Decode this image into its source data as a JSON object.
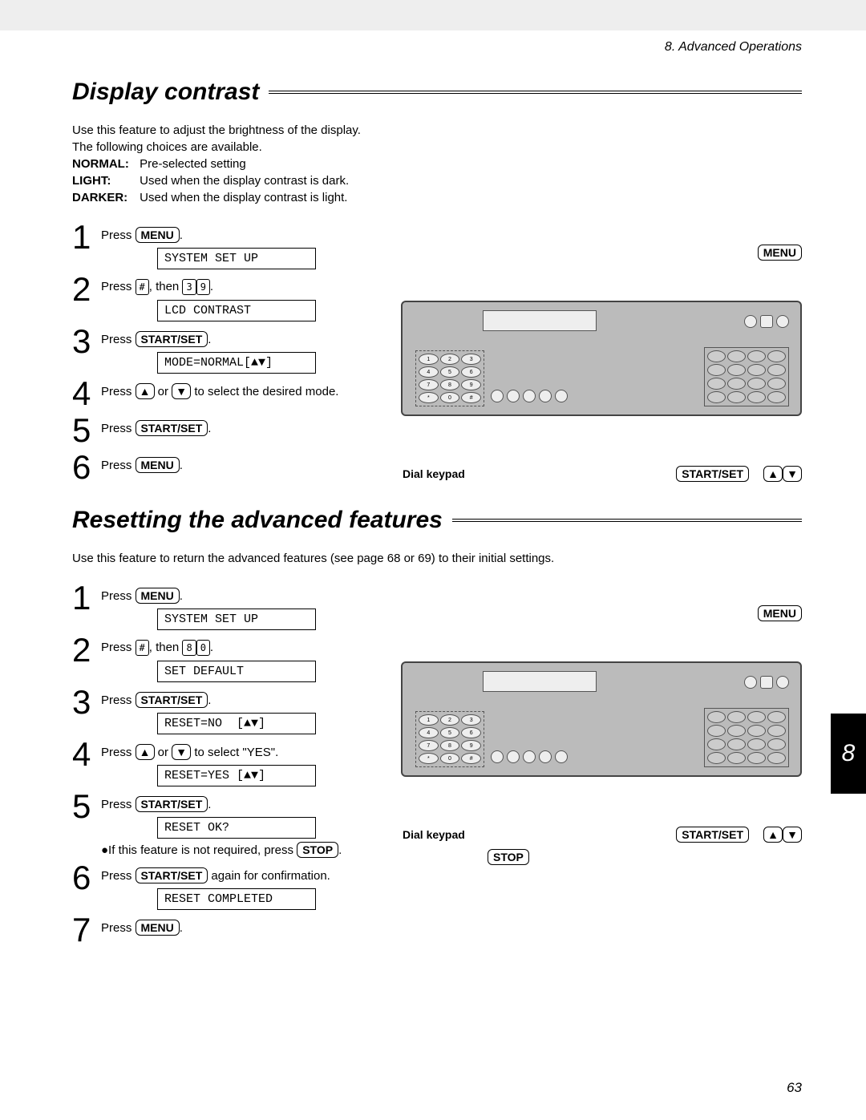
{
  "chapter": "8.  Advanced Operations",
  "section1": {
    "title": "Display contrast",
    "intro": "Use this feature to adjust the brightness of the display.\nThe following choices are available.",
    "opts": [
      {
        "name": "NORMAL:",
        "desc": "Pre-selected setting"
      },
      {
        "name": "LIGHT:",
        "desc": "Used when the display contrast is dark."
      },
      {
        "name": "DARKER:",
        "desc": "Used when the display contrast is light."
      }
    ],
    "steps": {
      "s1_text_a": "Press ",
      "s1_text_b": ".",
      "s1_lcd": "SYSTEM SET UP",
      "s2_text_a": "Press ",
      "s2_text_b": ", then ",
      "s2_text_c": ".",
      "s2_k1": "#",
      "s2_k2": "3",
      "s2_k3": "9",
      "s2_lcd": "LCD CONTRAST",
      "s3_text_a": "Press ",
      "s3_text_b": ".",
      "s3_lcd": "MODE=NORMAL[▲▼]",
      "s4_text_a": "Press ",
      "s4_text_b": " or ",
      "s4_text_c": " to select the desired mode.",
      "s5_text_a": "Press ",
      "s5_text_b": ".",
      "s6_text_a": "Press ",
      "s6_text_b": "."
    },
    "callout": {
      "menu": "MENU",
      "dial": "Dial keypad",
      "startset": "START/SET",
      "up": "▲",
      "down": "▼"
    }
  },
  "section2": {
    "title": "Resetting the advanced features",
    "intro": "Use this feature to return the advanced features (see page 68 or 69) to their initial settings.",
    "steps": {
      "s1_text_a": "Press ",
      "s1_text_b": ".",
      "s1_lcd": "SYSTEM SET UP",
      "s2_text_a": "Press ",
      "s2_text_b": ", then ",
      "s2_text_c": ".",
      "s2_k1": "#",
      "s2_k2": "8",
      "s2_k3": "0",
      "s2_lcd": "SET DEFAULT",
      "s3_text_a": "Press ",
      "s3_text_b": ".",
      "s3_lcd": "RESET=NO  [▲▼]",
      "s4_text_a": "Press ",
      "s4_text_b": " or ",
      "s4_text_c": " to select \"YES\".",
      "s4_lcd": "RESET=YES [▲▼]",
      "s5_text_a": "Press ",
      "s5_text_b": ".",
      "s5_lcd": "RESET OK?",
      "s5_note_a": "●If this feature is not required, press ",
      "s5_note_b": ".",
      "s6_text_a": "Press ",
      "s6_text_b": " again for confirmation.",
      "s6_lcd": "RESET COMPLETED",
      "s7_text_a": "Press ",
      "s7_text_b": "."
    },
    "callout": {
      "menu": "MENU",
      "dial": "Dial keypad",
      "startset": "START/SET",
      "stop": "STOP",
      "up": "▲",
      "down": "▼"
    }
  },
  "keys": {
    "menu": "MENU",
    "startset": "START/SET",
    "stop": "STOP",
    "up": "▲",
    "down": "▼"
  },
  "side_tab": "8",
  "page_num": "63"
}
